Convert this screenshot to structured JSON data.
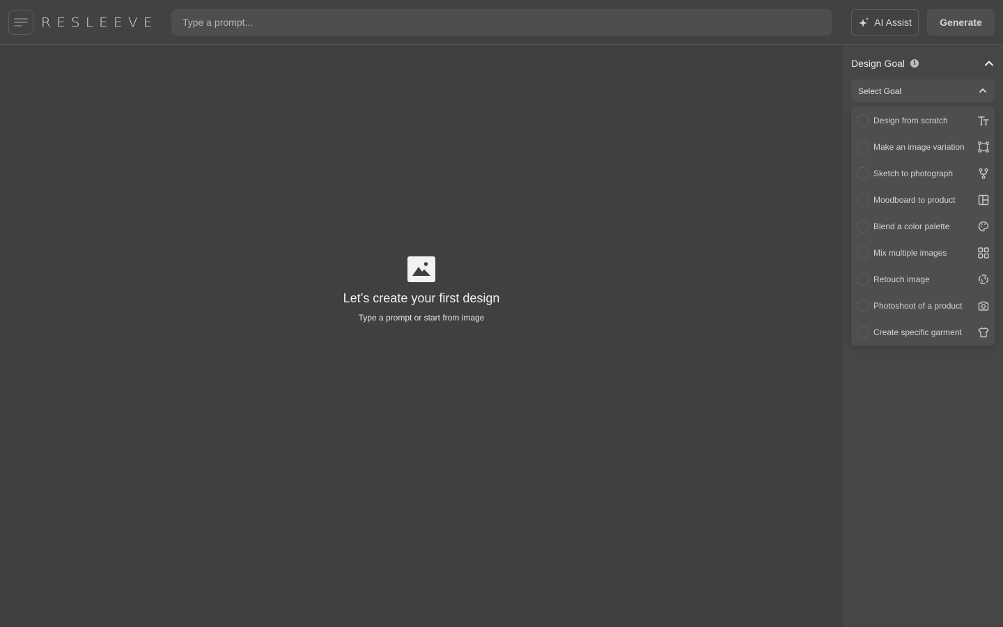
{
  "app": {
    "logo": "RESLEEVE"
  },
  "topbar": {
    "prompt_placeholder": "Type a prompt...",
    "prompt_value": "",
    "ai_assist_label": "AI Assist",
    "generate_label": "Generate"
  },
  "canvas": {
    "empty_title": "Let’s create your first design",
    "empty_subtitle": "Type a prompt or start from image"
  },
  "sidebar": {
    "section_title": "Design Goal",
    "select_placeholder": "Select Goal",
    "goals": [
      {
        "label": "Design from scratch",
        "icon": "text-size-icon",
        "selected": false
      },
      {
        "label": "Make an image variation",
        "icon": "transform-icon",
        "selected": false
      },
      {
        "label": "Sketch to photograph",
        "icon": "branch-icon",
        "selected": false
      },
      {
        "label": "Moodboard to product",
        "icon": "layout-icon",
        "selected": false
      },
      {
        "label": "Blend a color palette",
        "icon": "palette-icon",
        "selected": false
      },
      {
        "label": "Mix multiple images",
        "icon": "grid-icon",
        "selected": false
      },
      {
        "label": "Retouch image",
        "icon": "spinner-icon",
        "selected": false
      },
      {
        "label": "Photoshoot of a product",
        "icon": "camera-icon",
        "selected": false
      },
      {
        "label": "Create specific garment",
        "icon": "shirt-icon",
        "selected": false
      }
    ]
  }
}
